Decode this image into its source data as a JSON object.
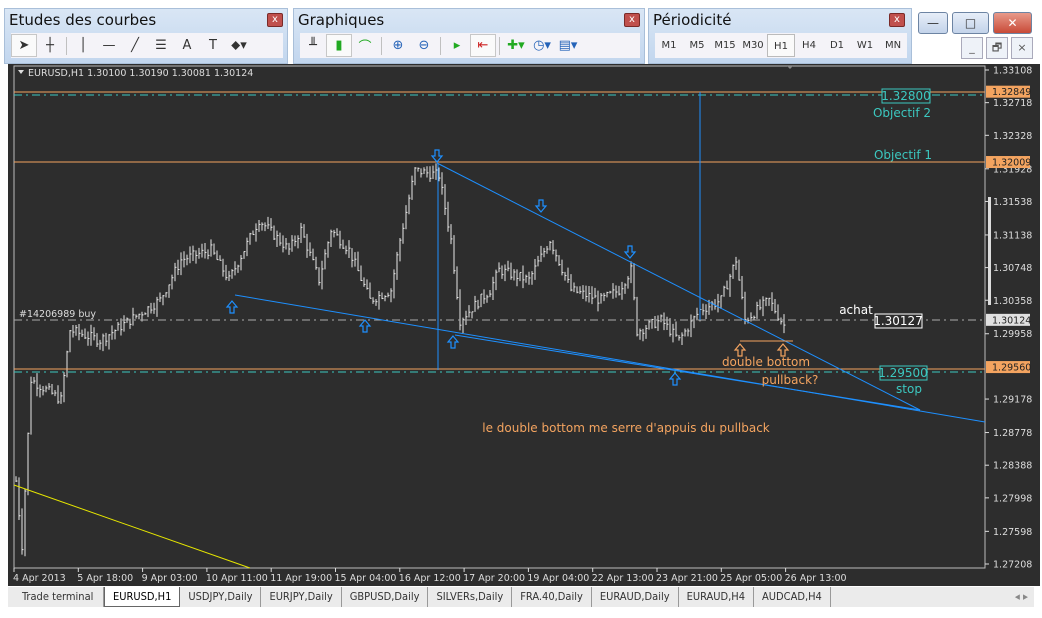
{
  "toolbars": {
    "studies": {
      "title": "Etudes des courbes",
      "close": "x",
      "tools": [
        "cursor-icon",
        "crosshair-icon",
        "vertical-line-icon",
        "horizontal-line-icon",
        "trendline-icon",
        "fibonacci-icon",
        "text-icon",
        "text-label-icon",
        "arrows-icon"
      ],
      "tool_labels": {
        "text": "A",
        "label": "T"
      }
    },
    "charts": {
      "title": "Graphiques",
      "close": "x",
      "tools": [
        "bar-chart-icon",
        "candlestick-icon",
        "line-chart-icon",
        "zoom-in-icon",
        "zoom-out-icon",
        "autoscroll-icon",
        "chart-shift-icon",
        "indicators-icon",
        "periods-icon",
        "templates-icon"
      ]
    },
    "periods": {
      "title": "Périodicité",
      "close": "x",
      "items": [
        "M1",
        "M5",
        "M15",
        "M30",
        "H1",
        "H4",
        "D1",
        "W1",
        "MN"
      ],
      "selected": "H1"
    }
  },
  "window": {
    "minimize": "—",
    "maximize": "□",
    "close": "✕",
    "child_minimize": "_",
    "child_restore": "🗗",
    "child_close": "×"
  },
  "chart": {
    "header": "EURUSD,H1  1.30100 1.30190 1.30081 1.30124",
    "order_label": "#14206989 buy",
    "annotations": {
      "objectif2": "Objectif 2",
      "objectif1": "Objectif 1",
      "target2_box": "1.32800",
      "achat": "achat",
      "achat_box": "1.30127",
      "stop_box": "1.29500",
      "stop": "stop",
      "double_bottom": "double bottom",
      "pullback": "pullback?",
      "comment": "le double bottom me serre d'appuis du pullback"
    },
    "colors": {
      "background": "#2d2d2d",
      "bars": "#e8e8e8",
      "trendlines": "#1e90ff",
      "levels": "#f4a460",
      "teal": "#3cc8c0",
      "yellow": "#e6e600",
      "annotation": "#f4a460"
    }
  },
  "chart_data": {
    "type": "bar",
    "symbol": "EURUSD",
    "timeframe": "H1",
    "ylim": [
      1.27208,
      1.33108
    ],
    "y_ticks": [
      "1.33108",
      "1.32718",
      "1.32328",
      "1.31928",
      "1.31538",
      "1.31138",
      "1.30748",
      "1.30358",
      "1.29958",
      "1.29178",
      "1.28778",
      "1.28388",
      "1.27998",
      "1.27598",
      "1.27208"
    ],
    "price_markers": [
      {
        "label": "1.32849",
        "color": "#f4a460"
      },
      {
        "label": "1.32009",
        "color": "#f4a460"
      },
      {
        "label": "1.30124",
        "color": "#e0e0e0"
      },
      {
        "label": "1.29560",
        "color": "#f4a460"
      }
    ],
    "x_ticks": [
      "4 Apr 2013",
      "5 Apr 18:00",
      "9 Apr 03:00",
      "10 Apr 11:00",
      "11 Apr 19:00",
      "15 Apr 04:00",
      "16 Apr 12:00",
      "17 Apr 20:00",
      "19 Apr 04:00",
      "22 Apr 13:00",
      "23 Apr 21:00",
      "25 Apr 05:00",
      "26 Apr 13:00"
    ],
    "price_path": [
      [
        0,
        1.282
      ],
      [
        2,
        1.2743
      ],
      [
        5,
        1.2941
      ],
      [
        15,
        1.2917
      ],
      [
        18,
        1.3
      ],
      [
        28,
        1.2988
      ],
      [
        38,
        1.3012
      ],
      [
        48,
        1.3036
      ],
      [
        55,
        1.3084
      ],
      [
        65,
        1.3096
      ],
      [
        71,
        1.306
      ],
      [
        81,
        1.3132
      ],
      [
        91,
        1.3096
      ],
      [
        95,
        1.312
      ],
      [
        101,
        1.306
      ],
      [
        105,
        1.312
      ],
      [
        111,
        1.3096
      ],
      [
        118,
        1.3036
      ],
      [
        125,
        1.3048
      ],
      [
        128,
        1.3108
      ],
      [
        133,
        1.3191
      ],
      [
        141,
        1.3185
      ],
      [
        145,
        1.3108
      ],
      [
        148,
        1.3012
      ],
      [
        158,
        1.3048
      ],
      [
        161,
        1.3072
      ],
      [
        171,
        1.306
      ],
      [
        178,
        1.3108
      ],
      [
        185,
        1.3048
      ],
      [
        195,
        1.3036
      ],
      [
        201,
        1.3048
      ],
      [
        205,
        1.3072
      ],
      [
        207,
        1.2999
      ],
      [
        215,
        1.3012
      ],
      [
        221,
        1.2988
      ],
      [
        228,
        1.3024
      ],
      [
        235,
        1.3036
      ],
      [
        240,
        1.3084
      ],
      [
        243,
        1.3012
      ],
      [
        251,
        1.3036
      ],
      [
        256,
        1.3006
      ]
    ]
  }
}
